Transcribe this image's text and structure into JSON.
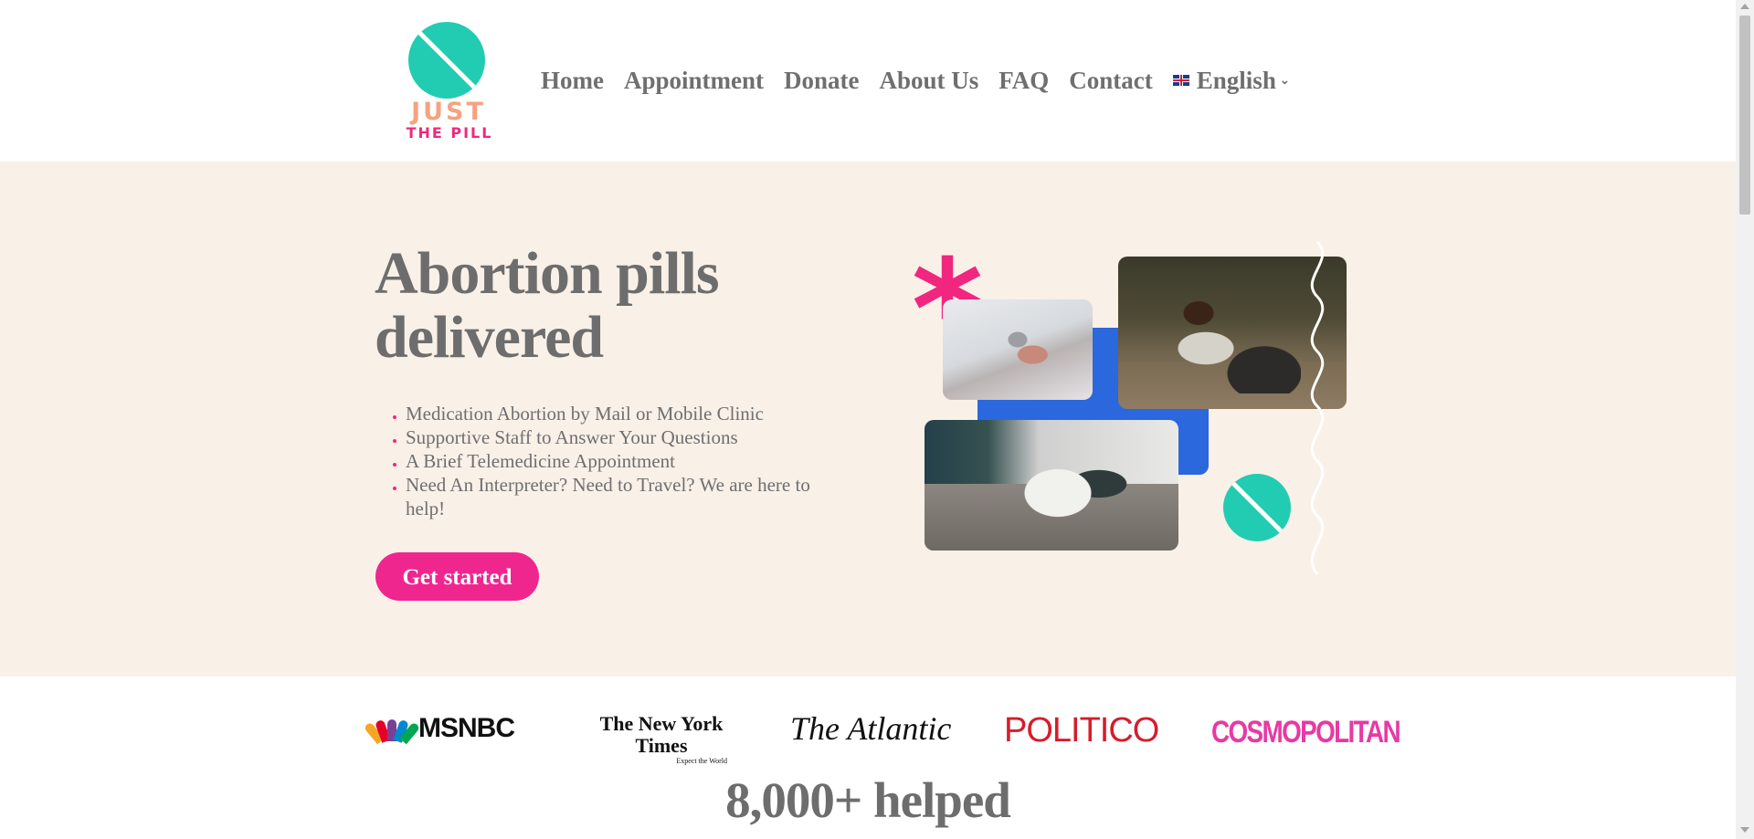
{
  "header": {
    "logo_line1": "JUST",
    "logo_line2": "THE PILL",
    "nav": [
      "Home",
      "Appointment",
      "Donate",
      "About Us",
      "FAQ",
      "Contact"
    ],
    "language": "English",
    "language_flag": "uk-flag-icon"
  },
  "hero": {
    "title": "Abortion pills delivered",
    "bullets": [
      "Medication Abortion by Mail or Mobile Clinic",
      "Supportive Staff to Answer Your Questions",
      "A Brief Telemedicine Appointment",
      "Need An Interpreter? Need to Travel? We are here to help!"
    ],
    "cta": "Get started"
  },
  "press": {
    "logos": {
      "msnbc": "MSNBC",
      "nyt": "The New York Times",
      "nyt_tagline": "Expect the World",
      "atlantic": "The Atlantic",
      "politico": "POLITICO",
      "cosmopolitan": "COSMOPOLITAN"
    }
  },
  "stats": {
    "helped": "8,000+ helped"
  },
  "colors": {
    "teal": "#22ccb3",
    "pink": "#f0268f",
    "blue": "#2b67dd",
    "hero_bg": "#f9f0e8",
    "text": "#6f6f6f"
  }
}
